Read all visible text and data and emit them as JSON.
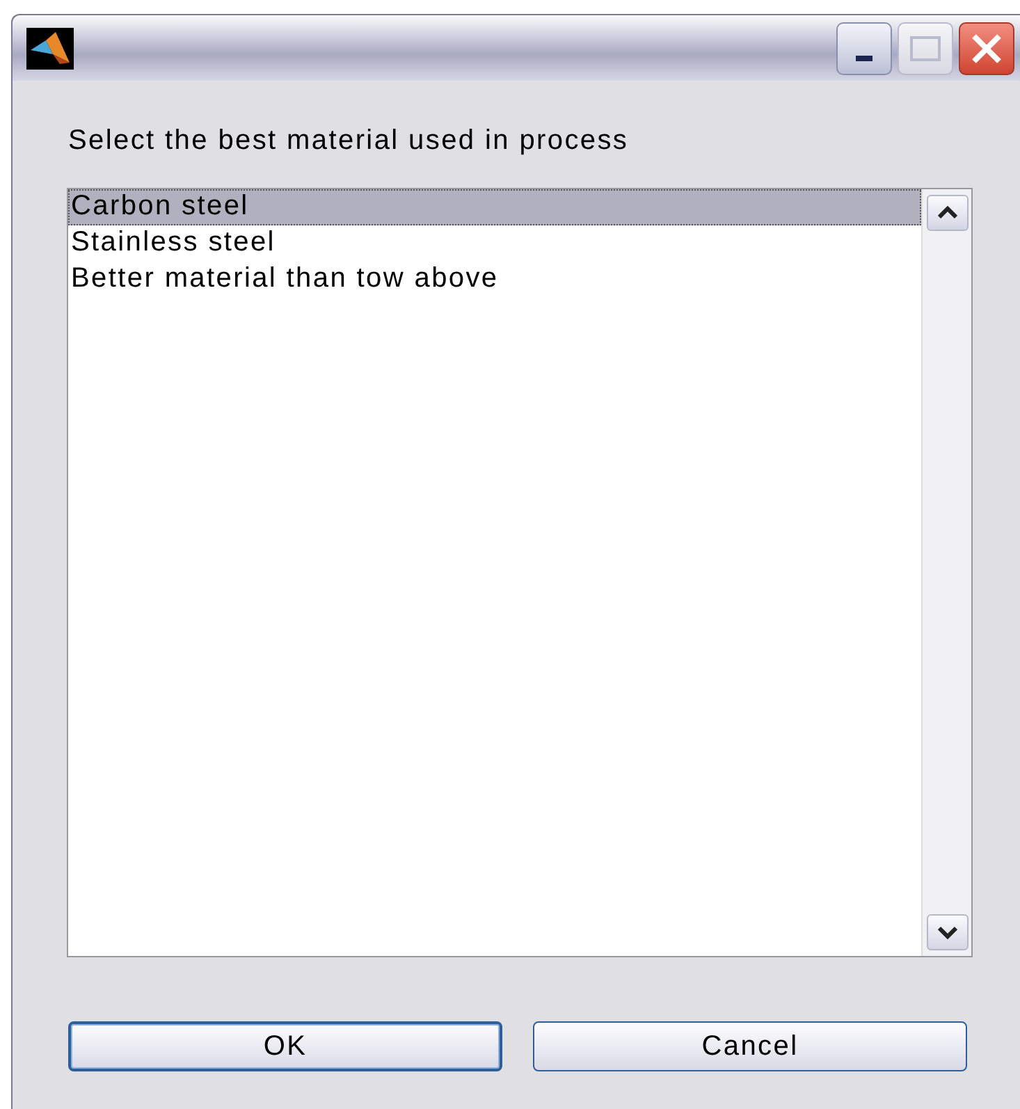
{
  "prompt": "Select the best material used in process",
  "list_items": [
    {
      "label": "Carbon steel",
      "selected": true
    },
    {
      "label": "Stainless steel",
      "selected": false
    },
    {
      "label": "Better material than tow above",
      "selected": false
    }
  ],
  "buttons": [
    {
      "label": "OK",
      "default": true
    },
    {
      "label": "Cancel",
      "default": false
    }
  ]
}
